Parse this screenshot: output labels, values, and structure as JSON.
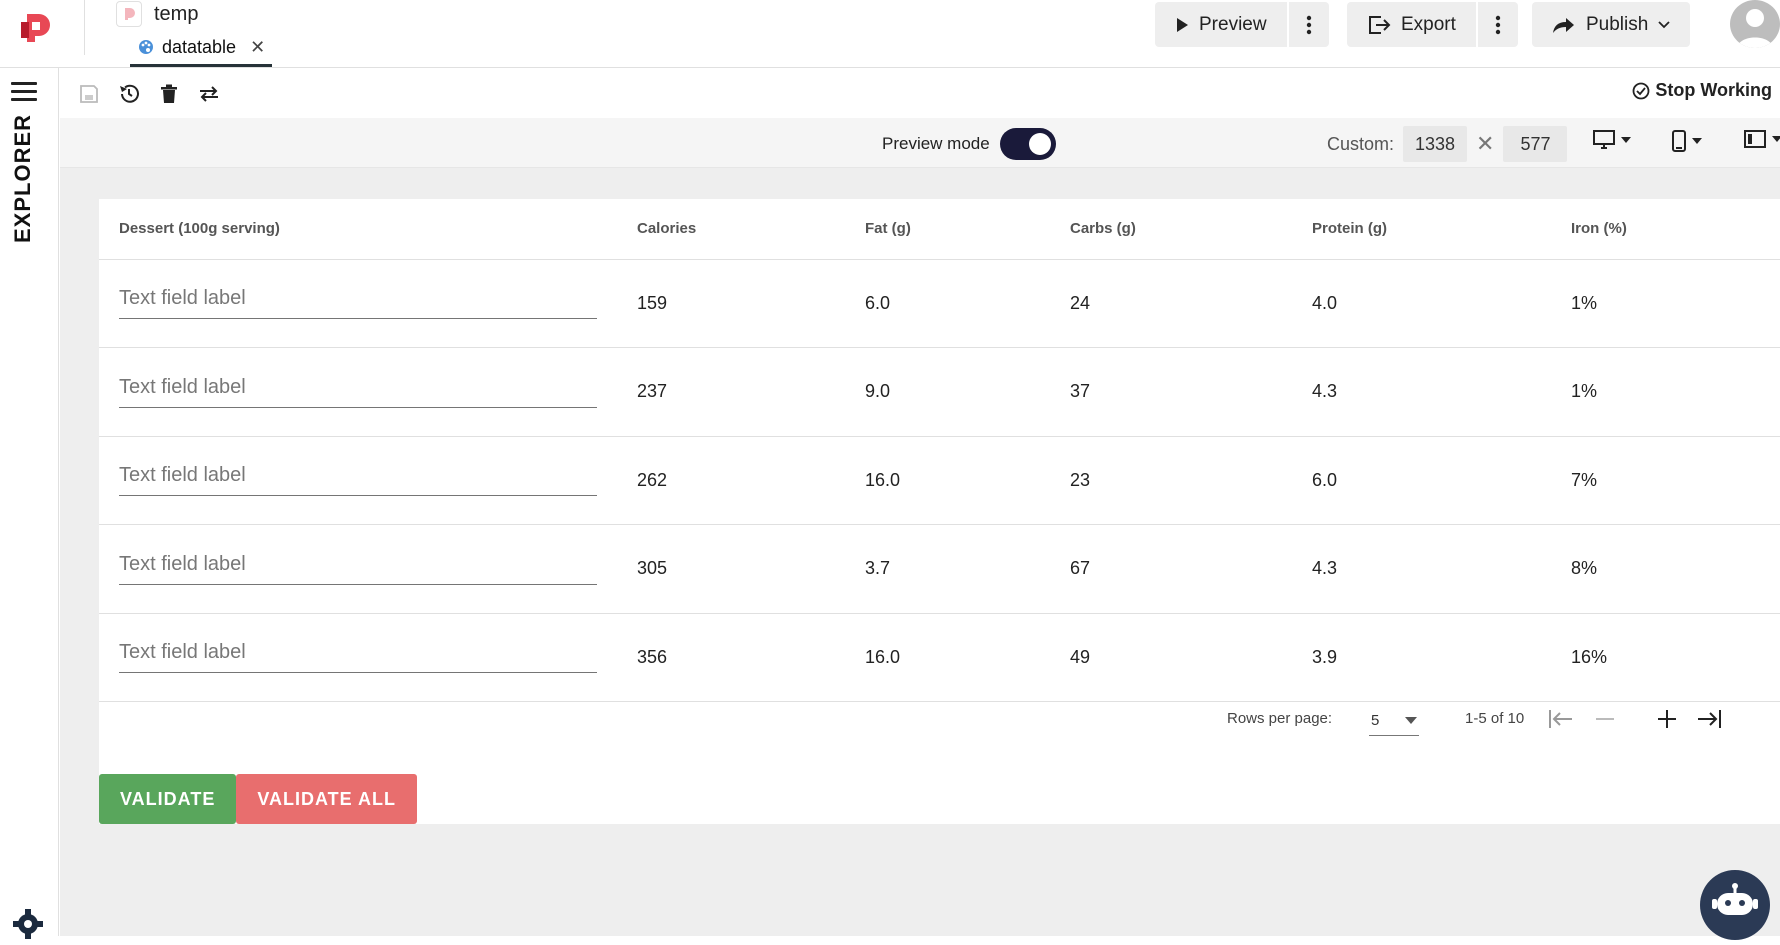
{
  "header": {
    "project_name": "temp",
    "tab_label": "datatable",
    "preview_label": "Preview",
    "export_label": "Export",
    "publish_label": "Publish"
  },
  "rail": {
    "explorer_label": "EXPLORER"
  },
  "toolbar": {
    "stop_working_label": "Stop Working"
  },
  "modebar": {
    "preview_mode_label": "Preview mode",
    "preview_mode_on": true,
    "custom_label": "Custom:",
    "width": "1338",
    "height": "577"
  },
  "table": {
    "columns": [
      "Dessert (100g serving)",
      "Calories",
      "Fat (g)",
      "Carbs (g)",
      "Protein (g)",
      "Iron (%)"
    ],
    "rows": [
      {
        "dessert": "Text field label",
        "calories": "159",
        "fat": "6.0",
        "carbs": "24",
        "protein": "4.0",
        "iron": "1%"
      },
      {
        "dessert": "Text field label",
        "calories": "237",
        "fat": "9.0",
        "carbs": "37",
        "protein": "4.3",
        "iron": "1%"
      },
      {
        "dessert": "Text field label",
        "calories": "262",
        "fat": "16.0",
        "carbs": "23",
        "protein": "6.0",
        "iron": "7%"
      },
      {
        "dessert": "Text field label",
        "calories": "305",
        "fat": "3.7",
        "carbs": "67",
        "protein": "4.3",
        "iron": "8%"
      },
      {
        "dessert": "Text field label",
        "calories": "356",
        "fat": "16.0",
        "carbs": "49",
        "protein": "3.9",
        "iron": "16%"
      }
    ]
  },
  "pagination": {
    "rows_per_page_label": "Rows per page:",
    "rows_per_page_value": "5",
    "range_label": "1-5 of 10"
  },
  "actions": {
    "validate_label": "VALIDATE",
    "validate_all_label": "VALIDATE ALL"
  },
  "colors": {
    "validate": "#59a65c",
    "validate_all": "#e86e6e",
    "brand": "#e84855",
    "toggle": "#1a1a3a"
  }
}
